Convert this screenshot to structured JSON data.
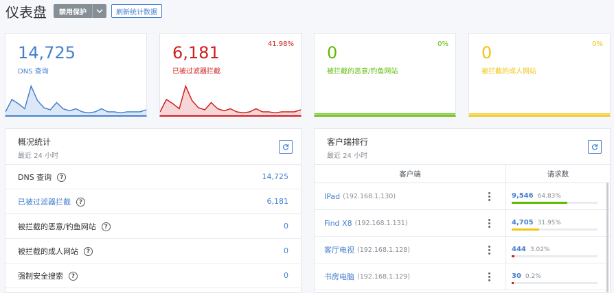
{
  "header": {
    "title": "仪表盘",
    "disable_protection_label": "禁用保护",
    "refresh_stats_label": "刷新统计数据"
  },
  "cards": [
    {
      "value": "14,725",
      "label": "DNS 查询",
      "percent": "",
      "color": "#467fcf",
      "fill": "#dce8f7",
      "sparkline": [
        2,
        14,
        10,
        5,
        27,
        13,
        6,
        4,
        11,
        5,
        3,
        5,
        2,
        1,
        2,
        5,
        2,
        2,
        1,
        2,
        2,
        2,
        4
      ]
    },
    {
      "value": "6,181",
      "label": "已被过滤器拦截",
      "percent": "41.98%",
      "color": "#cd201f",
      "fill": "#f6d6d6",
      "sparkline": [
        2,
        14,
        10,
        5,
        27,
        13,
        6,
        4,
        11,
        5,
        3,
        5,
        2,
        1,
        2,
        5,
        2,
        2,
        1,
        2,
        2,
        2,
        4
      ]
    },
    {
      "value": "0",
      "label": "被拦截的恶意/钓鱼网站",
      "percent": "0%",
      "color": "#5eba00",
      "fill": "#e8f4d8",
      "sparkline": [
        0,
        0,
        0,
        0,
        0,
        0,
        0,
        0,
        0,
        0,
        0,
        0,
        0,
        0,
        0,
        0,
        0,
        0,
        0,
        0,
        0,
        0,
        0
      ]
    },
    {
      "value": "0",
      "label": "被拦截的成人网站",
      "percent": "0%",
      "color": "#f1c40f",
      "fill": "#fdf4d3",
      "sparkline": [
        0,
        0,
        0,
        0,
        0,
        0,
        0,
        0,
        0,
        0,
        0,
        0,
        0,
        0,
        0,
        0,
        0,
        0,
        0,
        0,
        0,
        0,
        0
      ]
    }
  ],
  "overview": {
    "title": "概况统计",
    "subtitle": "最近 24 小时",
    "rows": [
      {
        "label": "DNS 查询",
        "value": "14,725",
        "label_color": "#333333"
      },
      {
        "label": "已被过滤器拦截",
        "value": "6,181",
        "label_color": "#467fcf"
      },
      {
        "label": "被拦截的恶意/钓鱼网站",
        "value": "0",
        "label_color": "#333333"
      },
      {
        "label": "被拦截的成人网站",
        "value": "0",
        "label_color": "#333333"
      },
      {
        "label": "强制安全搜索",
        "value": "0",
        "label_color": "#333333"
      }
    ]
  },
  "clients": {
    "title": "客户端排行",
    "subtitle": "最近 24 小时",
    "col_client": "客户端",
    "col_requests": "请求数",
    "rows": [
      {
        "name": "IPad",
        "ip": "(192.168.1.130)",
        "count": "9,546",
        "percent": "64.83%",
        "fraction": 0.6483,
        "bar_color": "#5eba00"
      },
      {
        "name": "Find X8",
        "ip": "(192.168.1.131)",
        "count": "4,705",
        "percent": "31.95%",
        "fraction": 0.3195,
        "bar_color": "#f1c40f"
      },
      {
        "name": "客厅电视",
        "ip": "(192.168.1.128)",
        "count": "444",
        "percent": "3.02%",
        "fraction": 0.0302,
        "bar_color": "#cd201f"
      },
      {
        "name": "书房电脑",
        "ip": "(192.168.1.129)",
        "count": "30",
        "percent": "0.2%",
        "fraction": 0.002,
        "bar_color": "#cd201f"
      }
    ]
  }
}
